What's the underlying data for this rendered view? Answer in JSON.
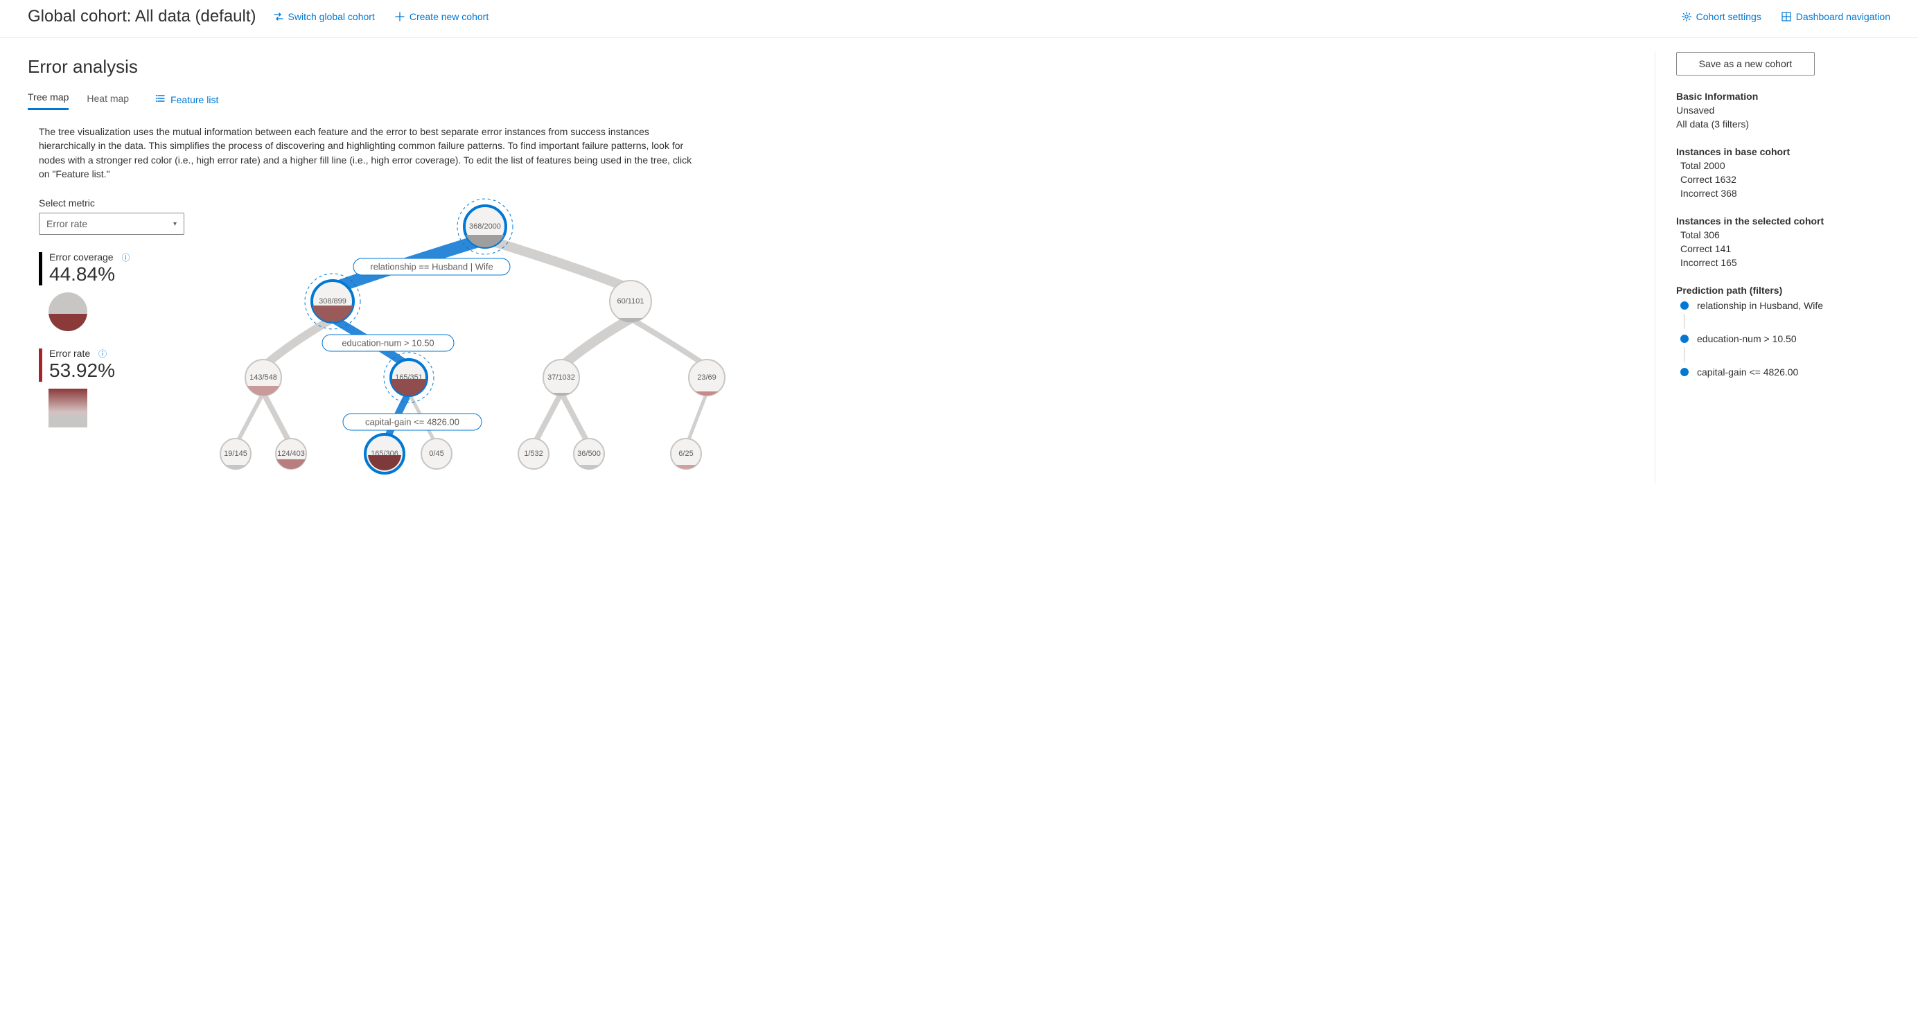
{
  "header": {
    "title": "Global cohort: All data (default)",
    "switch_label": "Switch global cohort",
    "create_label": "Create new cohort",
    "cohort_settings_label": "Cohort settings",
    "dashboard_nav_label": "Dashboard navigation"
  },
  "page": {
    "title": "Error analysis",
    "tabs": {
      "tree": "Tree map",
      "heat": "Heat map"
    },
    "feature_list_label": "Feature list",
    "description": "The tree visualization uses the mutual information between each feature and the error to best separate error instances from success instances hierarchically in the data. This simplifies the process of discovering and highlighting common failure patterns. To find important failure patterns, look for nodes with a stronger red color (i.e., high error rate) and a higher fill line (i.e., high error coverage). To edit the list of features being used in the tree, click on \"Feature list.\""
  },
  "metrics": {
    "select_label": "Select metric",
    "select_value": "Error rate",
    "coverage_label": "Error coverage",
    "coverage_value": "44.84%",
    "rate_label": "Error rate",
    "rate_value": "53.92%"
  },
  "tree": {
    "nodes": {
      "root": "368/2000",
      "l1a": "308/899",
      "l1b": "60/1101",
      "l2a": "143/548",
      "l2b": "165/351",
      "l2c": "37/1032",
      "l2d": "23/69",
      "l3a": "19/145",
      "l3b": "124/403",
      "l3c": "165/306",
      "l3d": "0/45",
      "l3e": "1/532",
      "l3f": "36/500",
      "l3g": "6/25"
    },
    "rules": {
      "r1": "relationship == Husband | Wife",
      "r2": "education-num > 10.50",
      "r3": "capital-gain <= 4826.00"
    }
  },
  "side": {
    "save_label": "Save as a new cohort",
    "basic_title": "Basic Information",
    "basic_status": "Unsaved",
    "basic_cohort": "All data (3 filters)",
    "base_title": "Instances in base cohort",
    "base_total_label": "Total",
    "base_total": "2000",
    "base_correct_label": "Correct",
    "base_correct": "1632",
    "base_incorrect_label": "Incorrect",
    "base_incorrect": "368",
    "sel_title": "Instances in the selected cohort",
    "sel_total_label": "Total",
    "sel_total": "306",
    "sel_correct_label": "Correct",
    "sel_correct": "141",
    "sel_incorrect_label": "Incorrect",
    "sel_incorrect": "165",
    "pp_title": "Prediction path (filters)",
    "pp": [
      "relationship in Husband, Wife",
      "education-num > 10.50",
      "capital-gain <= 4826.00"
    ]
  },
  "chart_data": {
    "type": "tree",
    "title": "Error analysis tree",
    "metric": "Error rate",
    "root": {
      "errors": 368,
      "total": 2000,
      "selected": true,
      "children": [
        {
          "condition": "relationship == Husband | Wife",
          "errors": 308,
          "total": 899,
          "selected": true,
          "children": [
            {
              "condition_negated": true,
              "errors": 143,
              "total": 548,
              "children": [
                {
                  "errors": 19,
                  "total": 145
                },
                {
                  "errors": 124,
                  "total": 403
                }
              ]
            },
            {
              "condition": "education-num > 10.50",
              "errors": 165,
              "total": 351,
              "selected": true,
              "children": [
                {
                  "condition": "capital-gain <= 4826.00",
                  "errors": 165,
                  "total": 306,
                  "selected": true
                },
                {
                  "errors": 0,
                  "total": 45
                }
              ]
            }
          ]
        },
        {
          "condition_negated": true,
          "errors": 60,
          "total": 1101,
          "children": [
            {
              "errors": 37,
              "total": 1032,
              "children": [
                {
                  "errors": 1,
                  "total": 532
                },
                {
                  "errors": 36,
                  "total": 500
                }
              ]
            },
            {
              "errors": 23,
              "total": 69,
              "children": [
                {
                  "errors": 6,
                  "total": 25
                }
              ]
            }
          ]
        }
      ]
    },
    "selected_path_summary": {
      "error_coverage": 0.4484,
      "error_rate": 0.5392
    }
  }
}
